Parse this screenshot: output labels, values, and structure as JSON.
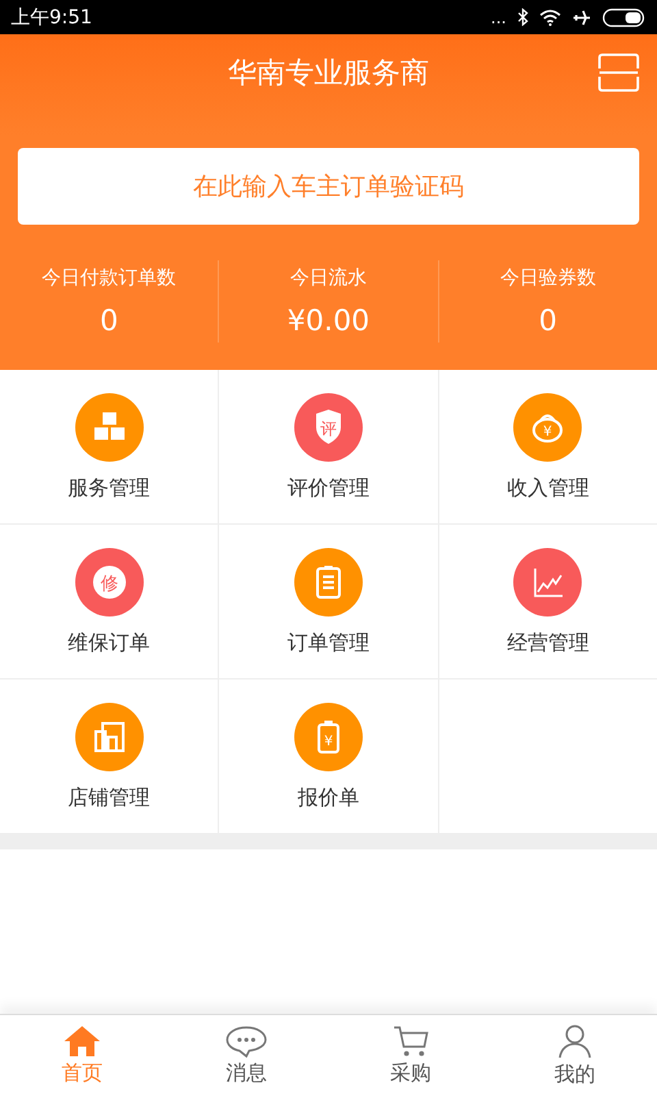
{
  "status_bar": {
    "time": "上午9:51",
    "dots": "..."
  },
  "header": {
    "title": "华南专业服务商"
  },
  "search": {
    "placeholder": "在此输入车主订单验证码"
  },
  "stats": [
    {
      "label": "今日付款订单数",
      "value": "0"
    },
    {
      "label": "今日流水",
      "value": "¥0.00"
    },
    {
      "label": "今日验券数",
      "value": "0"
    }
  ],
  "grid": [
    {
      "label": "服务管理",
      "kind": "boxes",
      "color": "#ff9100"
    },
    {
      "label": "评价管理",
      "kind": "shield",
      "glyph": "评",
      "color": "#f85a5a"
    },
    {
      "label": "收入管理",
      "kind": "moneybag",
      "glyph": "¥",
      "color": "#ff9100"
    },
    {
      "label": "维保订单",
      "kind": "badge",
      "glyph": "修",
      "color": "#f85a5a"
    },
    {
      "label": "订单管理",
      "kind": "clipboard",
      "color": "#ff9100"
    },
    {
      "label": "经营管理",
      "kind": "chart",
      "color": "#f85a5a"
    },
    {
      "label": "店铺管理",
      "kind": "store",
      "color": "#ff9100"
    },
    {
      "label": "报价单",
      "kind": "quote",
      "glyph": "¥",
      "color": "#ff9100"
    }
  ],
  "tabs": [
    {
      "label": "首页",
      "kind": "home",
      "selected": true
    },
    {
      "label": "消息",
      "kind": "chat",
      "selected": false
    },
    {
      "label": "采购",
      "kind": "cart",
      "selected": false
    },
    {
      "label": "我的",
      "kind": "user",
      "selected": false
    }
  ]
}
